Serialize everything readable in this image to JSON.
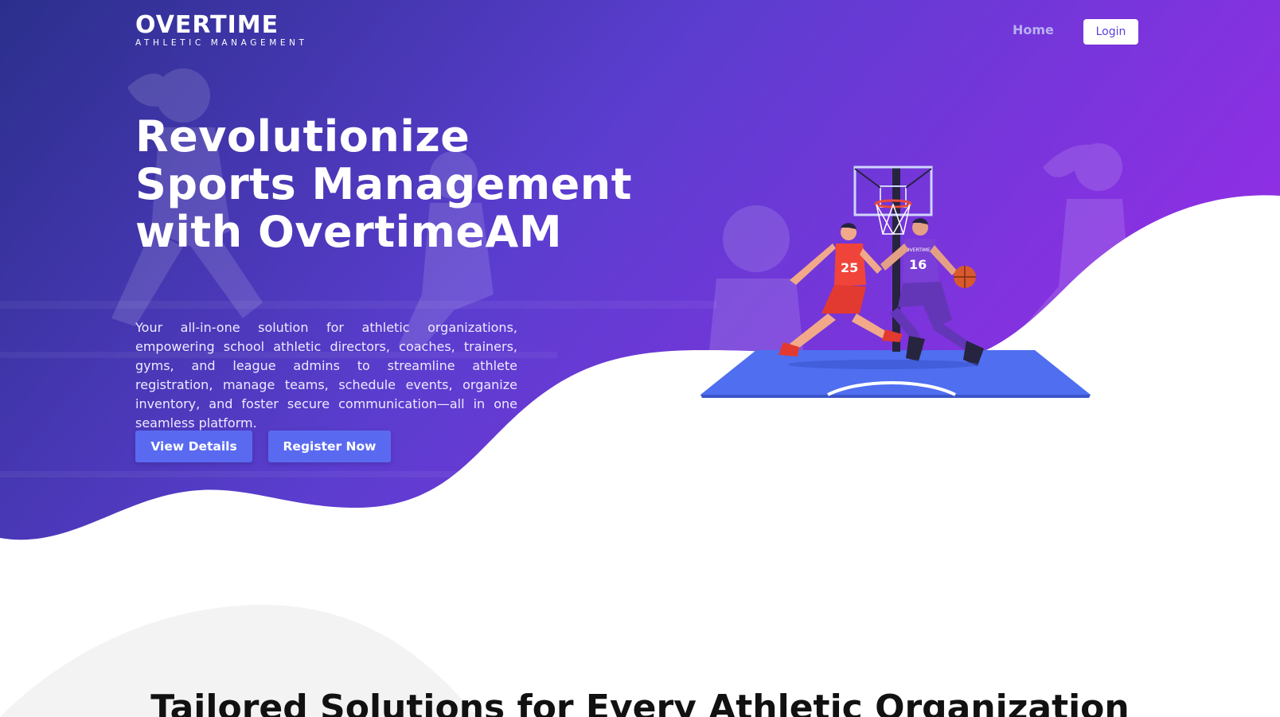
{
  "brand": {
    "name": "OVERTIME",
    "tagline": "ATHLETIC MANAGEMENT"
  },
  "nav": {
    "home_label": "Home",
    "login_label": "Login"
  },
  "hero": {
    "title": "Revolutionize Sports Management with OvertimeAM",
    "description": "Your all-in-one solution for athletic organizations, empowering school athletic directors, coaches, trainers, gyms, and league admins to streamline athlete registration, manage teams, schedule events, organize inventory, and foster secure communication—all in one seamless platform.",
    "view_details_label": "View Details",
    "register_label": "Register Now"
  },
  "illustration": {
    "player_red_number": "25",
    "player_purple_number": "16",
    "jersey_text": "OVERTIME"
  },
  "section2": {
    "title": "Tailored Solutions for Every Athletic Organization"
  },
  "colors": {
    "hero_gradient_start": "#2d2f8f",
    "hero_gradient_end": "#8a2be2",
    "button": "#5a6af0",
    "court": "#4f6ef0"
  }
}
